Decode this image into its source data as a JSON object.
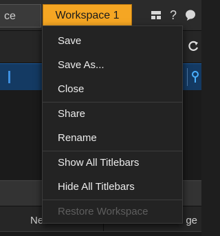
{
  "tabs": {
    "left_partial_label": "ce",
    "active_label": "Workspace 1"
  },
  "toolbar_icons": {
    "layout_icon": "▀",
    "help_icon": "?",
    "chat_icon": "●",
    "refresh_icon": "↻",
    "pin_icon": "⚲"
  },
  "table_header": {
    "left_partial": "Ne",
    "right_partial": "ge"
  },
  "colors": {
    "accent": "#f5a623",
    "menu_bg": "#232323",
    "menu_text": "#ececec",
    "menu_disabled": "#5e5e5e",
    "blue_strip": "#143a63"
  },
  "menu": {
    "save": "Save",
    "save_as": "Save As...",
    "close": "Close",
    "share": "Share",
    "rename": "Rename",
    "show_all_titlebars": "Show All Titlebars",
    "hide_all_titlebars": "Hide All Titlebars",
    "restore_workspace": "Restore Workspace"
  }
}
